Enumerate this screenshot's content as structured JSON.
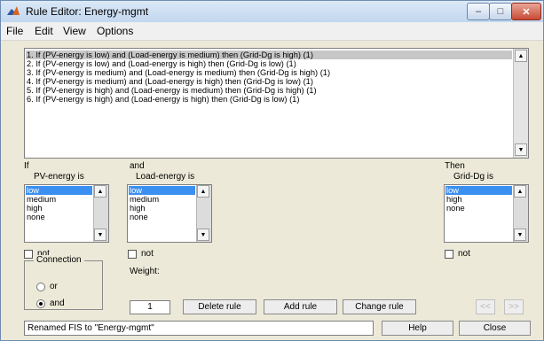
{
  "window": {
    "title": "Rule Editor: Energy-mgmt",
    "minimize": "–",
    "maximize": "□",
    "close": "✕"
  },
  "menu": [
    "File",
    "Edit",
    "View",
    "Options"
  ],
  "rules": [
    "1. If (PV-energy is low) and (Load-energy is medium) then (Grid-Dg is high) (1)",
    "2. If (PV-energy is low) and (Load-energy is high) then (Grid-Dg is low) (1)",
    "3. If (PV-energy is medium) and (Load-energy is medium) then (Grid-Dg is high) (1)",
    "4. If (PV-energy is medium) and (Load-energy is high) then (Grid-Dg is low) (1)",
    "5. If (PV-energy is high) and (Load-energy is medium) then (Grid-Dg is high) (1)",
    "6. If (PV-energy is high) and (Load-energy is high) then (Grid-Dg is low) (1)"
  ],
  "selected_rule_index": 0,
  "if_label": "If",
  "and_label": "and",
  "then_label": "Then",
  "inputs": [
    {
      "name_label": "PV-energy is",
      "options": [
        "low",
        "medium",
        "high",
        "none"
      ],
      "selected": "low",
      "not_label": "not"
    },
    {
      "name_label": "Load-energy is",
      "options": [
        "low",
        "medium",
        "high",
        "none"
      ],
      "selected": "low",
      "not_label": "not"
    }
  ],
  "output": {
    "name_label": "Grid-Dg is",
    "options": [
      "low",
      "high",
      "none"
    ],
    "selected": "low",
    "not_label": "not"
  },
  "connection": {
    "label": "Connection",
    "options": [
      "or",
      "and"
    ],
    "selected": "and"
  },
  "weight": {
    "label": "Weight:",
    "value": "1"
  },
  "buttons": {
    "delete": "Delete rule",
    "add": "Add rule",
    "change": "Change rule",
    "prev": "<<",
    "next": ">>",
    "help": "Help",
    "close": "Close"
  },
  "status": "Renamed FIS to \"Energy-mgmt\"",
  "colors": {
    "selection": "#3b8ff0",
    "rule_highlight": "#c7c7c7",
    "titlebar": "#c3d7ef",
    "window_bg": "#ece9d8"
  }
}
